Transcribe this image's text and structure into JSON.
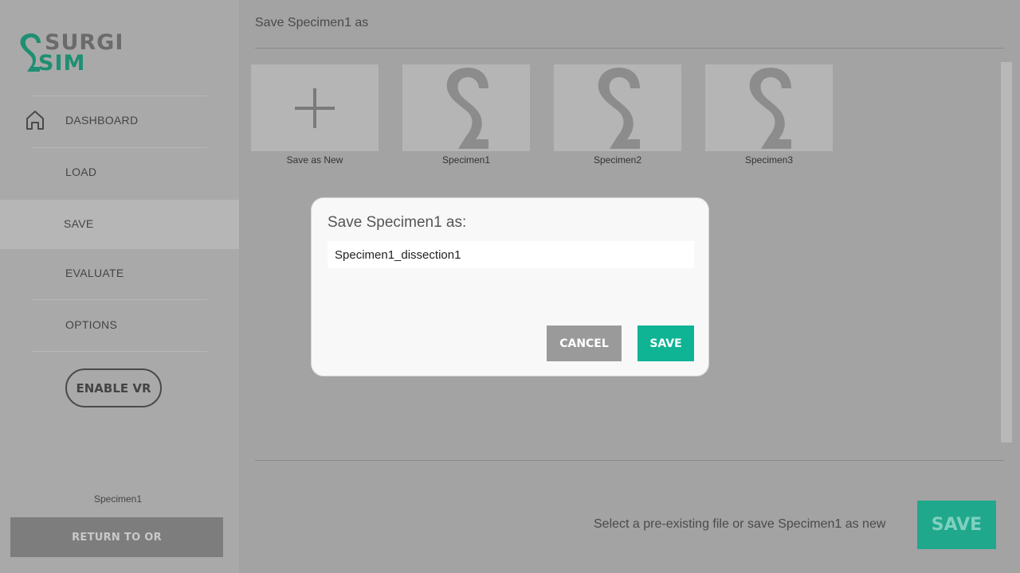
{
  "logo": {
    "line1": "SURGI",
    "line2": "SIM",
    "icon": "surgisim-logo-icon"
  },
  "sidebar": {
    "items": [
      {
        "label": "DASHBOARD",
        "icon": "home-icon",
        "active": false
      },
      {
        "label": "LOAD",
        "active": false
      },
      {
        "label": "SAVE",
        "active": true
      },
      {
        "label": "EVALUATE",
        "active": false
      },
      {
        "label": "OPTIONS",
        "active": false
      }
    ],
    "vr_button": "ENABLE VR",
    "current_file": "Specimen1",
    "return_button": "RETURN TO OR"
  },
  "main": {
    "title": "Save Specimen1 as",
    "files": [
      {
        "label": "Save as New",
        "icon": "plus-icon"
      },
      {
        "label": "Specimen1",
        "icon": "surgisim-s-icon"
      },
      {
        "label": "Specimen2",
        "icon": "surgisim-s-icon"
      },
      {
        "label": "Specimen3",
        "icon": "surgisim-s-icon"
      }
    ],
    "hint": "Select a pre-existing file or save Specimen1 as new",
    "save_button": "SAVE"
  },
  "modal": {
    "title": "Save Specimen1 as:",
    "input_value": "Specimen1_dissection1",
    "cancel_button": "CANCEL",
    "save_button": "SAVE"
  },
  "colors": {
    "accent": "#0fb495",
    "logo_green": "#1e8f72",
    "sidebar_bg": "#a9a9a9",
    "main_bg": "#a3a3a3"
  }
}
